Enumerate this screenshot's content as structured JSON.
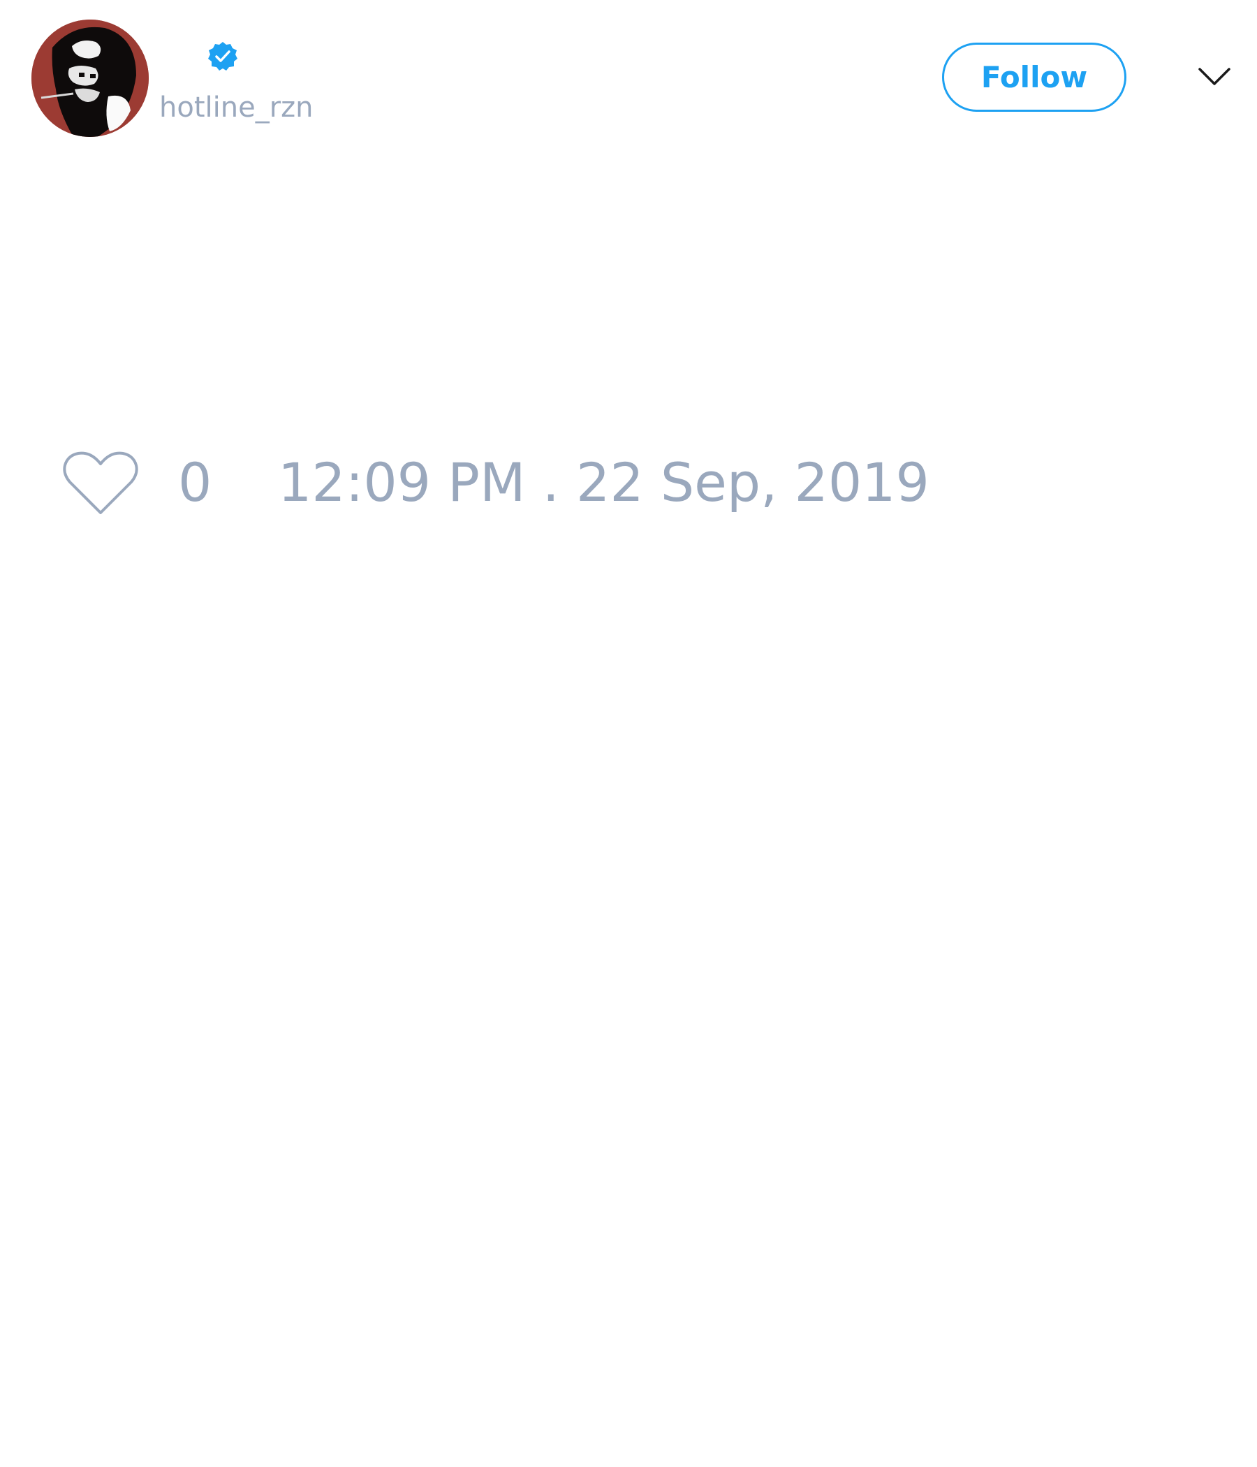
{
  "tweet": {
    "author": {
      "handle": "hotline_rzn",
      "verified": true,
      "avatar_icon": "profile-portrait",
      "avatar_background": "#9c3b33"
    },
    "header": {
      "follow_label": "Follow",
      "menu_icon": "chevron-down-icon"
    },
    "footer": {
      "like_icon": "heart-outline-icon",
      "like_count": "0",
      "timestamp": "12:09 PM . 22 Sep, 2019"
    }
  },
  "colors": {
    "accent": "#1da1f2",
    "muted_text": "#9aa8bd",
    "background": "#ffffff"
  }
}
